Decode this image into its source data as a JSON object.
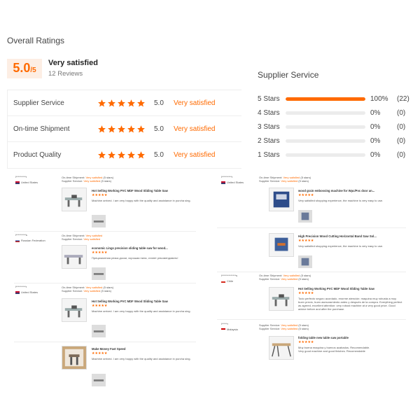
{
  "overall": {
    "title": "Overall Ratings",
    "score": "5.0",
    "score_den": "/5",
    "label": "Very satisfied",
    "count": "12 Reviews"
  },
  "ratings": [
    {
      "label": "Supplier Service",
      "value": "5.0",
      "text": "Very satisfied"
    },
    {
      "label": "On-time Shipment",
      "value": "5.0",
      "text": "Very satisfied"
    },
    {
      "label": "Product Quality",
      "value": "5.0",
      "text": "Very satisfied"
    }
  ],
  "supplier_service": {
    "title": "Supplier Service",
    "rows": [
      {
        "label": "5 Stars",
        "fraction": 1.0,
        "pct": "100%",
        "count": "(22)"
      },
      {
        "label": "4 Stars",
        "fraction": 0,
        "pct": "0%",
        "count": "(0)"
      },
      {
        "label": "3 Stars",
        "fraction": 0,
        "pct": "0%",
        "count": "(0)"
      },
      {
        "label": "2 Stars",
        "fraction": 0,
        "pct": "0%",
        "count": "(0)"
      },
      {
        "label": "1 Stars",
        "fraction": 0,
        "pct": "0%",
        "count": "(0)"
      }
    ]
  },
  "colors": {
    "accent": "#ff6a00",
    "score_bg": "#fdeee4",
    "bar_bg": "#ececec"
  },
  "reviews": {
    "shipment_label": "On-time Shipment:",
    "service_label": "Supplier Service:",
    "satisfied": "Very satisfied",
    "stars_suffix": "(5 stars)",
    "left": [
      {
        "user": "l*********r",
        "country": "United States",
        "product": "Hot Selling Working PVC MDF Wood Sliding Table Saw",
        "text": "Machine arrived. I am very happy with the quality and assistance in purcha sing."
      },
      {
        "user": "l*********s",
        "country": "Russian Federation",
        "product": "economic Lings precision sliding table saw for wood...",
        "text": "Прецизионная резка доски, хорошая пила, станет рекомендовать!"
      },
      {
        "user": "l*********r",
        "country": "United States",
        "product": "Hot Selling Working PVC MDF Wood Sliding Table Saw",
        "text": "Machine arrived. I am very happy with the quality and assistance in purcha sing."
      },
      {
        "product": "Make Money Fast Speed",
        "text": "Machine arrived. I am very happy with the quality and assistance in purcha sing."
      }
    ],
    "right": [
      {
        "user": "l*********r",
        "country": "United States",
        "product": "wood grain embossing machine for Wpc/Pvc door an...",
        "text": "Very satisfied shopping experience, the machine is very easy to use."
      },
      {
        "product": "High Precision Wood Cutting Horizontal Band Saw Sol...",
        "text": "Very satisfied shopping experience, the machine is very easy to use."
      },
      {
        "user": "l*************s",
        "country": "Chile",
        "product": "Hot Selling Working PVC MDF Wood Sliding Table Saw",
        "text": "Todo perfecto seguro acordado, enorme atención: maquina muy robusta a muy buen precio, buen asesoramiento antes y después de la compra. Everything perfect as agreed, excellent attention: very robust machine at a very good price. Good advice before and after the purchase."
      },
      {
        "user": "l*****r",
        "country": "Malaysia",
        "product": "folding table new table saw portable",
        "text": "Muy buena maquina y buenos acabados. Recomendable. Very good machine and good finishes. Recomendable"
      }
    ]
  }
}
